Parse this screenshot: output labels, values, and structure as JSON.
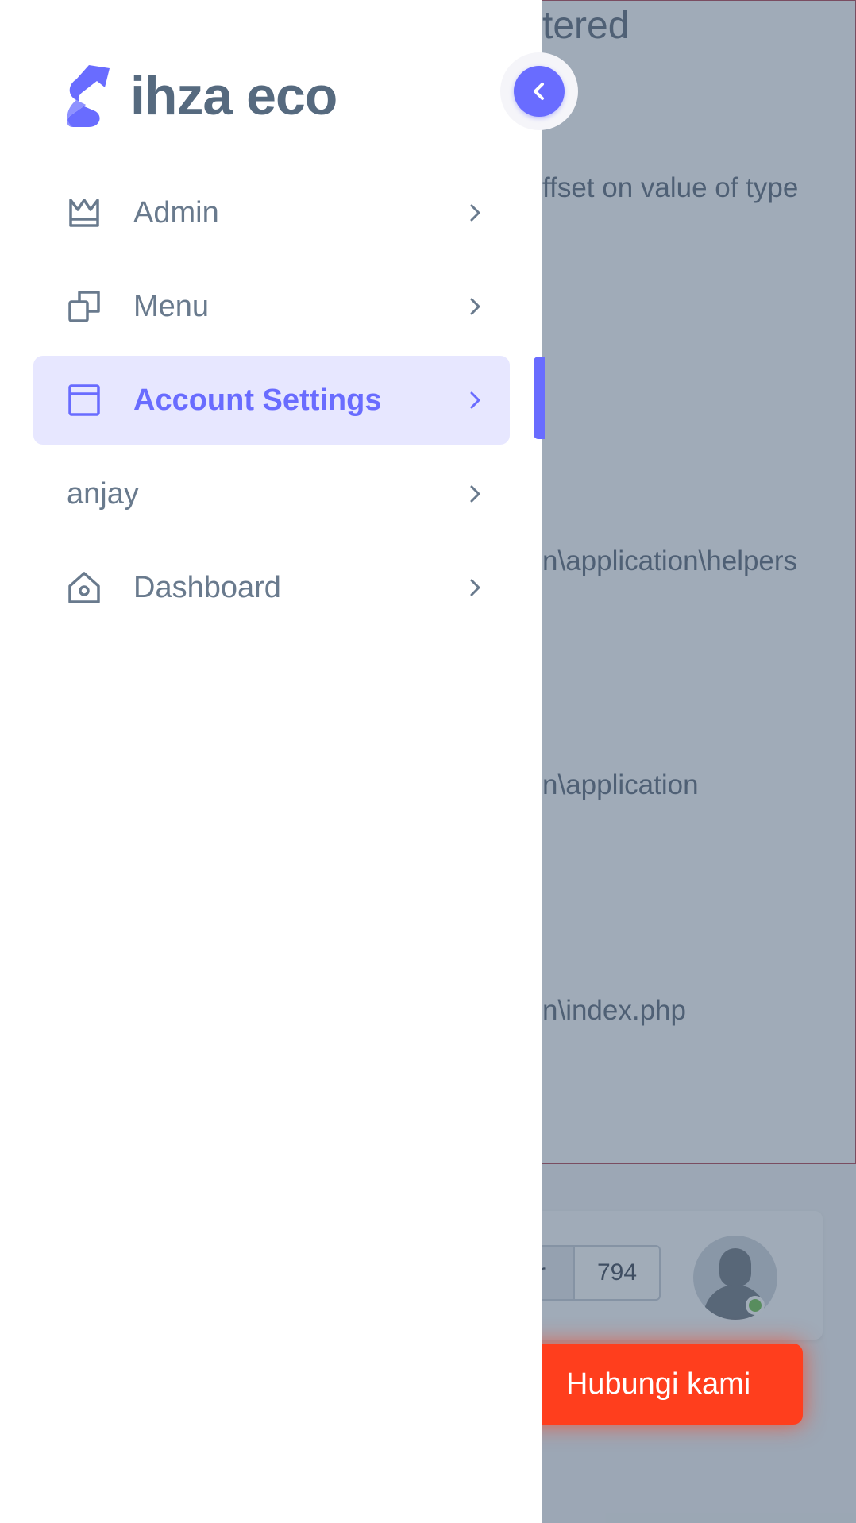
{
  "sidebar": {
    "brand": {
      "name": "ihza eco",
      "logo_icon": "brand-s-logo-icon"
    },
    "toggle": {
      "icon": "chevron-left-icon"
    },
    "items": [
      {
        "label": "Admin",
        "icon": "crown-icon",
        "active": false
      },
      {
        "label": "Menu",
        "icon": "copy-icon",
        "active": false
      },
      {
        "label": "Account Settings",
        "icon": "window-icon",
        "active": true
      },
      {
        "label": "anjay",
        "icon": "",
        "active": false
      },
      {
        "label": "Dashboard",
        "icon": "home-icon",
        "active": false
      }
    ]
  },
  "background_page": {
    "error": {
      "title": "tered",
      "lines": [
        "ffset on value of type",
        "n\\application\\helpers",
        "n\\application",
        "n\\index.php"
      ]
    },
    "pagination": {
      "prev_label": "r",
      "page_number": "794"
    },
    "contact_button": "Hubungi kami"
  },
  "colors": {
    "primary": "#696cff",
    "active_bg": "#e7e7ff",
    "menu_text": "#697a8d",
    "brand_text": "#566a7f",
    "contact_button": "#ff3e1d",
    "online_status": "#6cc04a"
  }
}
